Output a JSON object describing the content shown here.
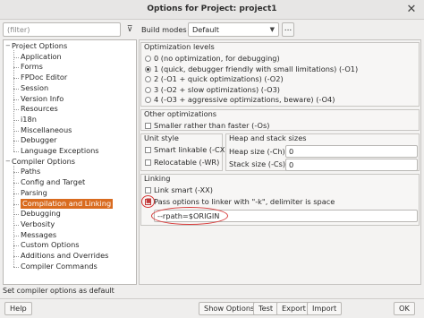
{
  "window": {
    "title": "Options for Project: project1",
    "close_glyph": "✕"
  },
  "filter": {
    "placeholder": "(filter)",
    "button_glyph": "⊽"
  },
  "tree": {
    "items": [
      {
        "label": "Project Options",
        "level": 0,
        "toggle": "−"
      },
      {
        "label": "Application",
        "level": 1
      },
      {
        "label": "Forms",
        "level": 1
      },
      {
        "label": "FPDoc Editor",
        "level": 1
      },
      {
        "label": "Session",
        "level": 1
      },
      {
        "label": "Version Info",
        "level": 1
      },
      {
        "label": "Resources",
        "level": 1
      },
      {
        "label": "i18n",
        "level": 1
      },
      {
        "label": "Miscellaneous",
        "level": 1
      },
      {
        "label": "Debugger",
        "level": 1
      },
      {
        "label": "Language Exceptions",
        "level": 1
      },
      {
        "label": "Compiler Options",
        "level": 0,
        "toggle": "−"
      },
      {
        "label": "Paths",
        "level": 1
      },
      {
        "label": "Config and Target",
        "level": 1
      },
      {
        "label": "Parsing",
        "level": 1
      },
      {
        "label": "Compilation and Linking",
        "level": 1,
        "selected": true
      },
      {
        "label": "Debugging",
        "level": 1
      },
      {
        "label": "Verbosity",
        "level": 1
      },
      {
        "label": "Messages",
        "level": 1
      },
      {
        "label": "Custom Options",
        "level": 1
      },
      {
        "label": "Additions and Overrides",
        "level": 1
      },
      {
        "label": "Compiler Commands",
        "level": 1
      }
    ]
  },
  "status_text": "Set compiler options as default",
  "build_modes": {
    "label": "Build modes",
    "value": "Default",
    "dots": "..."
  },
  "optimization": {
    "title": "Optimization levels",
    "options": [
      "0 (no optimization, for debugging)",
      "1 (quick, debugger friendly with small limitations) (-O1)",
      "2 (-O1 + quick optimizations) (-O2)",
      "3 (-O2 + slow optimizations) (-O3)",
      "4 (-O3 + aggressive optimizations, beware) (-O4)"
    ],
    "selected_index": 1
  },
  "other_opt": {
    "title": "Other optimizations",
    "smaller": "Smaller rather than faster (-Os)"
  },
  "unit_style": {
    "title": "Unit style",
    "smart": "Smart linkable (-CX)",
    "relocatable": "Relocatable (-WR)"
  },
  "heap": {
    "title": "Heap and stack sizes",
    "heap_label": "Heap size (-Ch)",
    "heap_value": "0",
    "stack_label": "Stack size (-Cs)",
    "stack_value": "0"
  },
  "linking": {
    "title": "Linking",
    "link_smart": "Link smart (-XX)",
    "pass_options": "Pass options to linker with \"-k\", delimiter is space",
    "pass_options_checked": true,
    "linker_options_value": "--rpath=$ORIGIN"
  },
  "buttons": {
    "help": "Help",
    "show_options": "Show Options",
    "test": "Test",
    "export": "Export",
    "import": "Import",
    "ok": "OK"
  },
  "colors": {
    "selection": "#d96b1f",
    "highlight_annotation": "#d83a3a"
  }
}
